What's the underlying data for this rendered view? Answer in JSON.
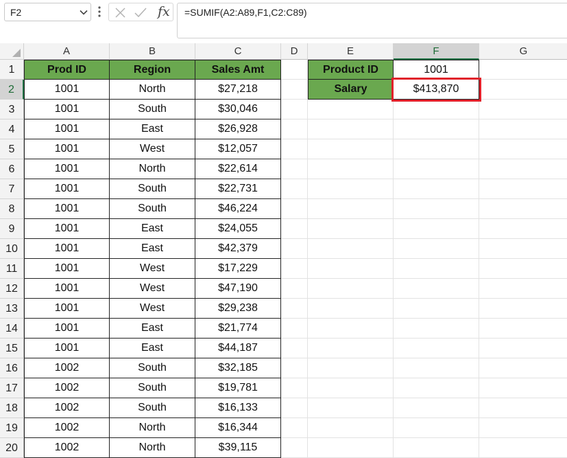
{
  "formula_bar": {
    "name_box": "F2",
    "fx_label": "fx",
    "formula": "=SUMIF(A2:A89,F1,C2:C89)"
  },
  "columns": [
    "A",
    "B",
    "C",
    "D",
    "E",
    "F",
    "G"
  ],
  "active_column": "F",
  "active_row": 2,
  "table": {
    "headers": [
      "Prod ID",
      "Region",
      "Sales Amt"
    ],
    "rows": [
      [
        "1001",
        "North",
        "$27,218"
      ],
      [
        "1001",
        "South",
        "$30,046"
      ],
      [
        "1001",
        "East",
        "$26,928"
      ],
      [
        "1001",
        "West",
        "$12,057"
      ],
      [
        "1001",
        "North",
        "$22,614"
      ],
      [
        "1001",
        "South",
        "$22,731"
      ],
      [
        "1001",
        "South",
        "$46,224"
      ],
      [
        "1001",
        "East",
        "$24,055"
      ],
      [
        "1001",
        "East",
        "$42,379"
      ],
      [
        "1001",
        "West",
        "$17,229"
      ],
      [
        "1001",
        "West",
        "$47,190"
      ],
      [
        "1001",
        "West",
        "$29,238"
      ],
      [
        "1001",
        "East",
        "$21,774"
      ],
      [
        "1001",
        "East",
        "$44,187"
      ],
      [
        "1002",
        "South",
        "$32,185"
      ],
      [
        "1002",
        "South",
        "$19,781"
      ],
      [
        "1002",
        "South",
        "$16,133"
      ],
      [
        "1002",
        "North",
        "$16,344"
      ],
      [
        "1002",
        "North",
        "$39,115"
      ]
    ]
  },
  "lookup": {
    "label1": "Product ID",
    "value1": "1001",
    "label2": "Salary",
    "value2": "$413,870"
  },
  "colors": {
    "header_fill": "#6aa84f",
    "selection_green": "#217346",
    "highlight_red": "#e0202a"
  }
}
